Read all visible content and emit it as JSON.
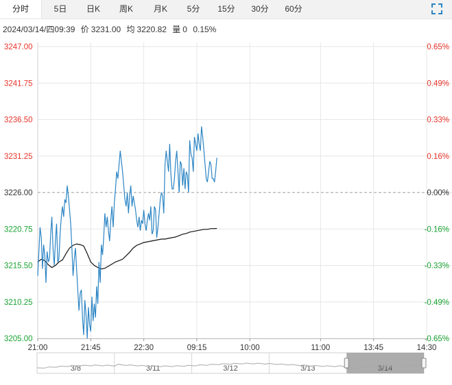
{
  "tabs": [
    {
      "label": "分时",
      "active": true
    },
    {
      "label": "5日"
    },
    {
      "label": "日K"
    },
    {
      "label": "周K"
    },
    {
      "label": "月K"
    },
    {
      "label": "5分"
    },
    {
      "label": "15分"
    },
    {
      "label": "30分"
    },
    {
      "label": "60分"
    }
  ],
  "info": {
    "datetime": "2024/03/14/四09:39",
    "price_label": "价",
    "price": "3231.00",
    "avg_label": "均",
    "avg": "3220.82",
    "vol_label": "量",
    "vol": "0",
    "change": "0.15%"
  },
  "colors": {
    "up": "#e8352c",
    "down": "#19a332",
    "flat": "#333333",
    "price_line": "#2a84c4",
    "avg_line": "#111111",
    "grid": "#e6e6e6",
    "ref_line": "#999999"
  },
  "icons": {
    "expand": "expand-icon"
  },
  "chart_data": {
    "type": "line",
    "y_ticks_left": [
      "3247.00",
      "3241.75",
      "3236.50",
      "3231.25",
      "3226.00",
      "3220.75",
      "3215.50",
      "3210.25",
      "3205.00"
    ],
    "y_ticks_right": [
      "0.65%",
      "0.49%",
      "0.33%",
      "0.16%",
      "0.00%",
      "-0.16%",
      "-0.33%",
      "-0.49%",
      "-0.65%"
    ],
    "ylim": [
      3205.0,
      3247.0
    ],
    "prev_close": 3226.0,
    "x_ticks": [
      "21:00",
      "21:45",
      "22:30",
      "09:15",
      "10:00",
      "11:00",
      "13:45",
      "14:30"
    ],
    "x_tick_pos": [
      0,
      45,
      90,
      135,
      180,
      240,
      285,
      330
    ],
    "x_range": [
      0,
      330
    ],
    "grid": true,
    "series": [
      {
        "x": [
          0,
          2,
          3,
          4,
          5,
          6,
          7,
          8,
          9,
          10,
          11,
          12,
          13,
          14,
          15,
          16,
          17,
          18,
          19,
          20,
          21,
          22,
          23,
          24,
          25,
          26,
          27,
          28,
          29,
          30,
          31,
          32,
          33,
          34,
          35,
          36,
          37,
          38,
          39,
          40,
          41,
          42,
          43,
          44,
          45,
          46,
          47,
          48,
          49,
          50,
          51,
          52,
          53,
          54,
          55,
          56,
          57,
          58,
          59,
          60,
          61,
          62,
          63,
          64,
          65,
          66,
          67,
          68,
          69,
          70,
          71,
          72,
          73,
          74,
          75,
          76,
          77,
          78,
          79,
          80,
          81,
          82,
          83,
          84,
          85,
          86,
          87,
          88,
          89,
          90,
          91,
          92,
          93,
          94,
          95,
          96,
          97,
          98,
          99,
          100,
          101,
          102,
          103,
          104,
          105,
          106,
          107,
          108,
          109,
          110,
          111,
          112,
          113,
          114,
          115,
          116,
          117,
          118,
          119,
          120,
          121,
          122,
          123,
          124,
          125,
          126,
          127,
          128,
          129,
          130,
          131,
          132,
          133,
          134,
          135,
          136,
          137,
          138,
          139,
          140,
          141,
          142,
          143,
          144,
          145,
          146,
          147,
          148,
          149,
          150,
          151,
          152
        ],
        "values": [
          3214.0,
          3221.0,
          3219.5,
          3215.0,
          3218.5,
          3217.0,
          3213.0,
          3217.5,
          3216.0,
          3216.5,
          3220.0,
          3222.5,
          3218.0,
          3215.5,
          3219.0,
          3221.5,
          3216.0,
          3216.5,
          3220.0,
          3222.5,
          3224.0,
          3222.5,
          3225.0,
          3224.5,
          3227.0,
          3225.5,
          3223.5,
          3221.5,
          3218.0,
          3214.0,
          3216.5,
          3218.0,
          3215.0,
          3212.0,
          3209.0,
          3211.5,
          3212.0,
          3208.0,
          3205.5,
          3210.5,
          3208.5,
          3205.0,
          3209.5,
          3207.0,
          3206.0,
          3211.0,
          3207.5,
          3210.0,
          3208.0,
          3212.5,
          3210.0,
          3216.0,
          3213.0,
          3218.5,
          3217.0,
          3219.5,
          3223.0,
          3221.0,
          3222.5,
          3220.5,
          3219.0,
          3222.0,
          3224.0,
          3221.0,
          3224.5,
          3226.5,
          3229.0,
          3228.0,
          3230.0,
          3232.0,
          3230.5,
          3229.0,
          3227.0,
          3225.0,
          3224.0,
          3226.0,
          3223.0,
          3225.5,
          3227.0,
          3224.0,
          3225.5,
          3224.5,
          3223.5,
          3222.0,
          3221.0,
          3222.5,
          3220.5,
          3222.0,
          3221.5,
          3223.5,
          3221.5,
          3220.5,
          3222.0,
          3223.0,
          3222.0,
          3224.0,
          3220.0,
          3220.5,
          3224.0,
          3223.5,
          3219.5,
          3221.0,
          3223.0,
          3225.0,
          3226.0,
          3225.5,
          3223.0,
          3230.0,
          3232.0,
          3230.5,
          3229.0,
          3233.0,
          3228.5,
          3226.5,
          3226.5,
          3228.0,
          3230.5,
          3232.0,
          3229.0,
          3226.0,
          3230.5,
          3230.0,
          3227.0,
          3229.5,
          3226.5,
          3229.0,
          3228.5,
          3226.0,
          3233.5,
          3231.5,
          3231.0,
          3229.0,
          3234.0,
          3233.0,
          3232.0,
          3234.5,
          3233.0,
          3232.0,
          3235.5,
          3234.0,
          3232.0,
          3230.0,
          3228.0,
          3227.5,
          3229.0,
          3230.5,
          3230.0,
          3228.0,
          3228.0,
          3227.5,
          3229.0,
          3231.0
        ]
      },
      {
        "x": [
          0,
          3,
          6,
          9,
          12,
          15,
          18,
          21,
          24,
          27,
          30,
          33,
          36,
          39,
          42,
          45,
          48,
          51,
          54,
          57,
          60,
          63,
          66,
          69,
          72,
          75,
          78,
          81,
          84,
          87,
          90,
          93,
          96,
          99,
          102,
          105,
          108,
          111,
          114,
          117,
          120,
          123,
          126,
          129,
          132,
          135,
          138,
          141,
          144,
          147,
          150,
          152
        ],
        "values": [
          3216.0,
          3216.4,
          3216.2,
          3215.6,
          3215.2,
          3215.5,
          3216.0,
          3216.3,
          3217.2,
          3218.0,
          3218.4,
          3218.6,
          3218.5,
          3218.3,
          3217.2,
          3216.0,
          3215.5,
          3215.2,
          3215.0,
          3215.1,
          3215.4,
          3215.7,
          3216.0,
          3216.2,
          3216.4,
          3216.9,
          3217.4,
          3218.0,
          3218.4,
          3218.6,
          3218.8,
          3218.9,
          3219.0,
          3219.1,
          3219.2,
          3219.3,
          3219.3,
          3219.4,
          3219.5,
          3219.6,
          3219.8,
          3220.0,
          3220.1,
          3220.3,
          3220.4,
          3220.5,
          3220.6,
          3220.7,
          3220.7,
          3220.8,
          3220.8,
          3220.82
        ]
      }
    ]
  },
  "navigator": {
    "dates": [
      "3/8",
      "3/11",
      "3/12",
      "3/13",
      "3/14"
    ],
    "selected_index": 4
  }
}
